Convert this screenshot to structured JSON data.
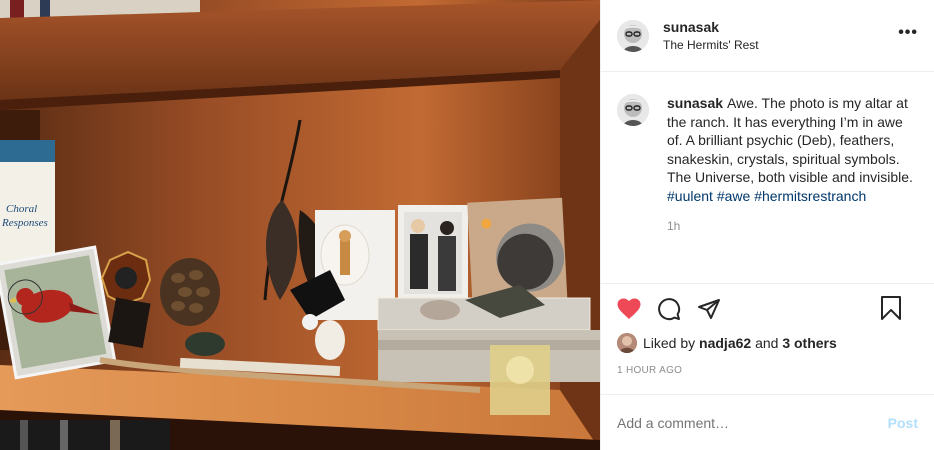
{
  "post": {
    "username": "sunasak",
    "location": "The Hermits' Rest",
    "more_label": "•••",
    "caption_user": "sunasak",
    "caption_text": "Awe. The photo is my altar at the ranch. It has everything I’m in awe of. A brilliant psychic (Deb), feathers, snakeskin, crystals, spiritual symbols. The Universe, both visible and invisible.",
    "hashtags": [
      "#uulent",
      "#awe",
      "#hermitsrestranch"
    ],
    "time_ago": "1h",
    "likes_prefix": "Liked by",
    "liked_by_user": "nadja62",
    "likes_and": "and",
    "likes_others": "3 others",
    "date": "1 HOUR AGO",
    "comment_placeholder": "Add a comment…",
    "post_button": "Post",
    "photo_book_title": "Choral Responses"
  },
  "colors": {
    "heart": "#ed4956",
    "hashtag": "#00376b",
    "post_button": "#b2dffc",
    "muted": "#8e8e8e"
  },
  "icons": [
    "heart-icon",
    "comment-icon",
    "share-icon",
    "bookmark-icon",
    "more-icon"
  ]
}
